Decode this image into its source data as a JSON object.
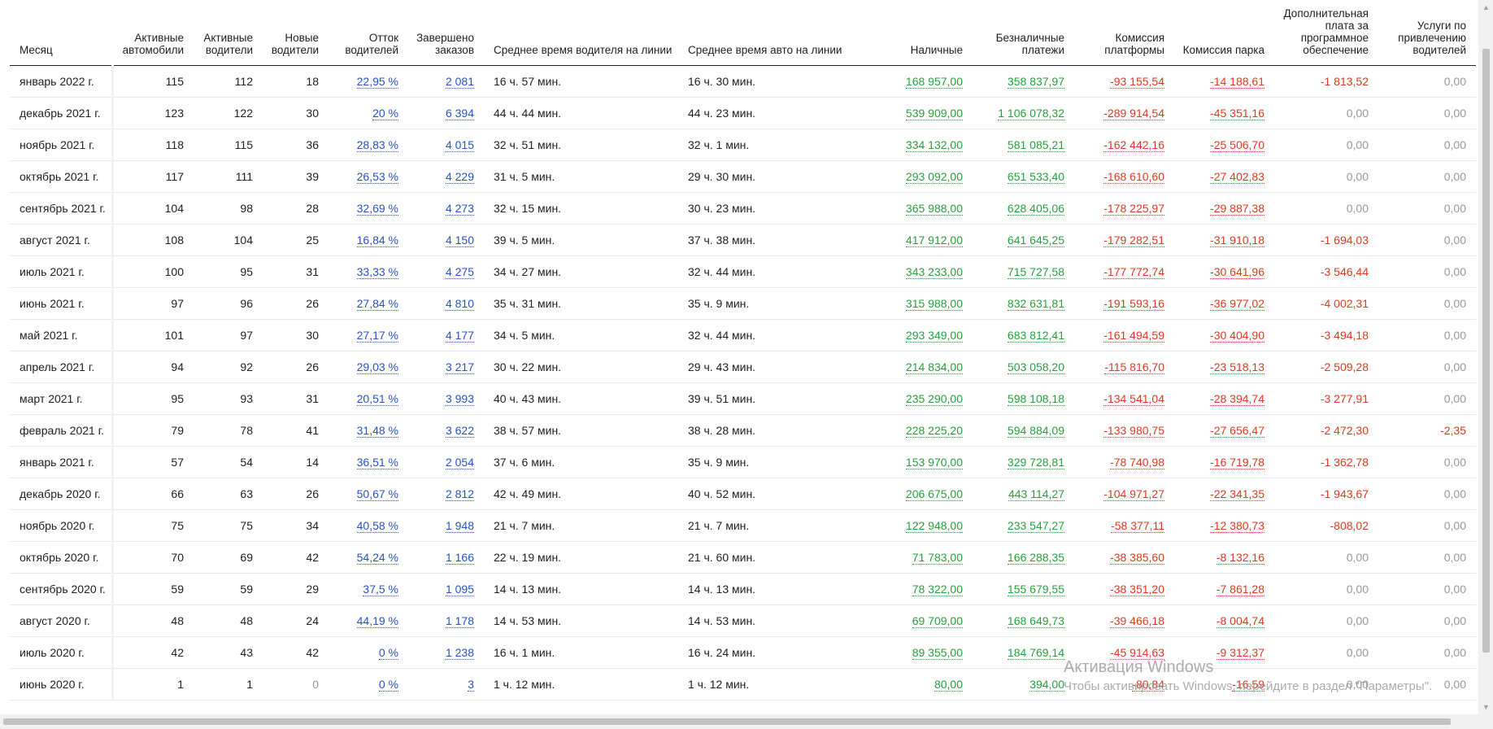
{
  "headers": {
    "month": "Месяц",
    "active_cars": "Активные автомобили",
    "active_drivers": "Активные водители",
    "new_drivers": "Новые водители",
    "driver_churn": "Отток водителей",
    "orders_completed": "Завершено заказов",
    "avg_driver_time": "Среднее время водителя на линии",
    "avg_car_time": "Среднее время авто на линии",
    "cash": "Наличные",
    "cashless": "Безналичные платежи",
    "platform_fee": "Комиссия платформы",
    "park_fee": "Комиссия парка",
    "software_fee": "Дополнительная плата за программное обеспечение",
    "recruit_services": "Услуги по привлечению водителей"
  },
  "rows": [
    {
      "month": "январь 2022 г.",
      "cars": "115",
      "drivers": "112",
      "new": "18",
      "churn": "22,95 %",
      "orders": "2 081",
      "dtime": "16 ч. 57 мин.",
      "ctime": "16 ч. 30 мин.",
      "cash": "168 957,00",
      "cashless": "358 837,97",
      "platform": "-93 155,54",
      "park": "-14 188,61",
      "software": "-1 813,52",
      "recruit": "0,00"
    },
    {
      "month": "декабрь 2021 г.",
      "cars": "123",
      "drivers": "122",
      "new": "30",
      "churn": "20 %",
      "orders": "6 394",
      "dtime": "44 ч. 44 мин.",
      "ctime": "44 ч. 23 мин.",
      "cash": "539 909,00",
      "cashless": "1 106 078,32",
      "platform": "-289 914,54",
      "park": "-45 351,16",
      "software": "0,00",
      "recruit": "0,00"
    },
    {
      "month": "ноябрь 2021 г.",
      "cars": "118",
      "drivers": "115",
      "new": "36",
      "churn": "28,83 %",
      "orders": "4 015",
      "dtime": "32 ч. 51 мин.",
      "ctime": "32 ч. 1 мин.",
      "cash": "334 132,00",
      "cashless": "581 085,21",
      "platform": "-162 442,16",
      "park": "-25 506,70",
      "software": "0,00",
      "recruit": "0,00"
    },
    {
      "month": "октябрь 2021 г.",
      "cars": "117",
      "drivers": "111",
      "new": "39",
      "churn": "26,53 %",
      "orders": "4 229",
      "dtime": "31 ч. 5 мин.",
      "ctime": "29 ч. 30 мин.",
      "cash": "293 092,00",
      "cashless": "651 533,40",
      "platform": "-168 610,60",
      "park": "-27 402,83",
      "software": "0,00",
      "recruit": "0,00"
    },
    {
      "month": "сентябрь 2021 г.",
      "cars": "104",
      "drivers": "98",
      "new": "28",
      "churn": "32,69 %",
      "orders": "4 273",
      "dtime": "32 ч. 15 мин.",
      "ctime": "30 ч. 23 мин.",
      "cash": "365 988,00",
      "cashless": "628 405,06",
      "platform": "-178 225,97",
      "park": "-29 887,38",
      "software": "0,00",
      "recruit": "0,00"
    },
    {
      "month": "август 2021 г.",
      "cars": "108",
      "drivers": "104",
      "new": "25",
      "churn": "16,84 %",
      "orders": "4 150",
      "dtime": "39 ч. 5 мин.",
      "ctime": "37 ч. 38 мин.",
      "cash": "417 912,00",
      "cashless": "641 645,25",
      "platform": "-179 282,51",
      "park": "-31 910,18",
      "software": "-1 694,03",
      "recruit": "0,00"
    },
    {
      "month": "июль 2021 г.",
      "cars": "100",
      "drivers": "95",
      "new": "31",
      "churn": "33,33 %",
      "orders": "4 275",
      "dtime": "34 ч. 27 мин.",
      "ctime": "32 ч. 44 мин.",
      "cash": "343 233,00",
      "cashless": "715 727,58",
      "platform": "-177 772,74",
      "park": "-30 641,96",
      "software": "-3 546,44",
      "recruit": "0,00"
    },
    {
      "month": "июнь 2021 г.",
      "cars": "97",
      "drivers": "96",
      "new": "26",
      "churn": "27,84 %",
      "orders": "4 810",
      "dtime": "35 ч. 31 мин.",
      "ctime": "35 ч. 9 мин.",
      "cash": "315 988,00",
      "cashless": "832 631,81",
      "platform": "-191 593,16",
      "park": "-36 977,02",
      "software": "-4 002,31",
      "recruit": "0,00"
    },
    {
      "month": "май 2021 г.",
      "cars": "101",
      "drivers": "97",
      "new": "30",
      "churn": "27,17 %",
      "orders": "4 177",
      "dtime": "34 ч. 5 мин.",
      "ctime": "32 ч. 44 мин.",
      "cash": "293 349,00",
      "cashless": "683 812,41",
      "platform": "-161 494,59",
      "park": "-30 404,90",
      "software": "-3 494,18",
      "recruit": "0,00"
    },
    {
      "month": "апрель 2021 г.",
      "cars": "94",
      "drivers": "92",
      "new": "26",
      "churn": "29,03 %",
      "orders": "3 217",
      "dtime": "30 ч. 22 мин.",
      "ctime": "29 ч. 43 мин.",
      "cash": "214 834,00",
      "cashless": "503 058,20",
      "platform": "-115 816,70",
      "park": "-23 518,13",
      "software": "-2 509,28",
      "recruit": "0,00"
    },
    {
      "month": "март 2021 г.",
      "cars": "95",
      "drivers": "93",
      "new": "31",
      "churn": "20,51 %",
      "orders": "3 993",
      "dtime": "40 ч. 43 мин.",
      "ctime": "39 ч. 51 мин.",
      "cash": "235 290,00",
      "cashless": "598 108,18",
      "platform": "-134 541,04",
      "park": "-28 394,74",
      "software": "-3 277,91",
      "recruit": "0,00"
    },
    {
      "month": "февраль 2021 г.",
      "cars": "79",
      "drivers": "78",
      "new": "41",
      "churn": "31,48 %",
      "orders": "3 622",
      "dtime": "38 ч. 57 мин.",
      "ctime": "38 ч. 28 мин.",
      "cash": "228 225,20",
      "cashless": "594 884,09",
      "platform": "-133 980,75",
      "park": "-27 656,47",
      "software": "-2 472,30",
      "recruit": "-2,35"
    },
    {
      "month": "январь 2021 г.",
      "cars": "57",
      "drivers": "54",
      "new": "14",
      "churn": "36,51 %",
      "orders": "2 054",
      "dtime": "37 ч. 6 мин.",
      "ctime": "35 ч. 9 мин.",
      "cash": "153 970,00",
      "cashless": "329 728,81",
      "platform": "-78 740,98",
      "park": "-16 719,78",
      "software": "-1 362,78",
      "recruit": "0,00"
    },
    {
      "month": "декабрь 2020 г.",
      "cars": "66",
      "drivers": "63",
      "new": "26",
      "churn": "50,67 %",
      "orders": "2 812",
      "dtime": "42 ч. 49 мин.",
      "ctime": "40 ч. 52 мин.",
      "cash": "206 675,00",
      "cashless": "443 114,27",
      "platform": "-104 971,27",
      "park": "-22 341,35",
      "software": "-1 943,67",
      "recruit": "0,00"
    },
    {
      "month": "ноябрь 2020 г.",
      "cars": "75",
      "drivers": "75",
      "new": "34",
      "churn": "40,58 %",
      "orders": "1 948",
      "dtime": "21 ч. 7 мин.",
      "ctime": "21 ч. 7 мин.",
      "cash": "122 948,00",
      "cashless": "233 547,27",
      "platform": "-58 377,11",
      "park": "-12 380,73",
      "software": "-808,02",
      "recruit": "0,00"
    },
    {
      "month": "октябрь 2020 г.",
      "cars": "70",
      "drivers": "69",
      "new": "42",
      "churn": "54,24 %",
      "orders": "1 166",
      "dtime": "22 ч. 19 мин.",
      "ctime": "21 ч. 60 мин.",
      "cash": "71 783,00",
      "cashless": "166 288,35",
      "platform": "-38 385,60",
      "park": "-8 132,16",
      "software": "0,00",
      "recruit": "0,00"
    },
    {
      "month": "сентябрь 2020 г.",
      "cars": "59",
      "drivers": "59",
      "new": "29",
      "churn": "37,5 %",
      "orders": "1 095",
      "dtime": "14 ч. 13 мин.",
      "ctime": "14 ч. 13 мин.",
      "cash": "78 322,00",
      "cashless": "155 679,55",
      "platform": "-38 351,20",
      "park": "-7 861,28",
      "software": "0,00",
      "recruit": "0,00"
    },
    {
      "month": "август 2020 г.",
      "cars": "48",
      "drivers": "48",
      "new": "24",
      "churn": "44,19 %",
      "orders": "1 178",
      "dtime": "14 ч. 53 мин.",
      "ctime": "14 ч. 53 мин.",
      "cash": "69 709,00",
      "cashless": "168 649,73",
      "platform": "-39 466,18",
      "park": "-8 004,74",
      "software": "0,00",
      "recruit": "0,00"
    },
    {
      "month": "июль 2020 г.",
      "cars": "42",
      "drivers": "43",
      "new": "42",
      "churn": "0 %",
      "orders": "1 238",
      "dtime": "16 ч. 1 мин.",
      "ctime": "16 ч. 24 мин.",
      "cash": "89 355,00",
      "cashless": "184 769,14",
      "platform": "-45 914,63",
      "park": "-9 312,37",
      "software": "0,00",
      "recruit": "0,00"
    },
    {
      "month": "июнь 2020 г.",
      "cars": "1",
      "drivers": "1",
      "new": "0",
      "churn": "0 %",
      "orders": "3",
      "dtime": "1 ч. 12 мин.",
      "ctime": "1 ч. 12 мин.",
      "cash": "80,00",
      "cashless": "394,00",
      "platform": "-80,84",
      "park": "-16,59",
      "software": "0,00",
      "recruit": "0,00"
    }
  ],
  "watermark": {
    "title": "Активация Windows",
    "subtitle": "Чтобы активировать Windows, перейдите в раздел \"Параметры\"."
  },
  "colors": {
    "link_blue": "#2754cc",
    "positive_green": "#25a33b",
    "negative_red": "#e43a1e",
    "muted_gray": "#9a9a9a"
  }
}
